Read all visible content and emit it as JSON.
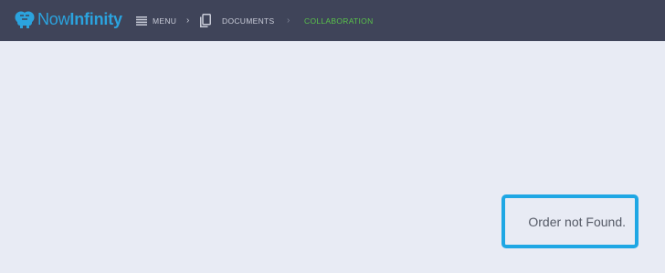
{
  "brand": {
    "now": "Now",
    "infinity": "Infinity",
    "logo_icon": "brain-icon"
  },
  "nav": {
    "menu_label": "MENU",
    "menu_icon": "hamburger-icon",
    "separator": "›",
    "documents_label": "DOCUMENTS",
    "documents_icon": "document-icon",
    "collaboration_label": "COLLABORATION"
  },
  "message": {
    "text": "Order not Found."
  },
  "colors": {
    "topbar": "#3f4459",
    "brand": "#2ba3de",
    "active_crumb": "#59c24a",
    "highlight_border": "#1ea7e4",
    "page_bg": "#e8ebf4"
  }
}
